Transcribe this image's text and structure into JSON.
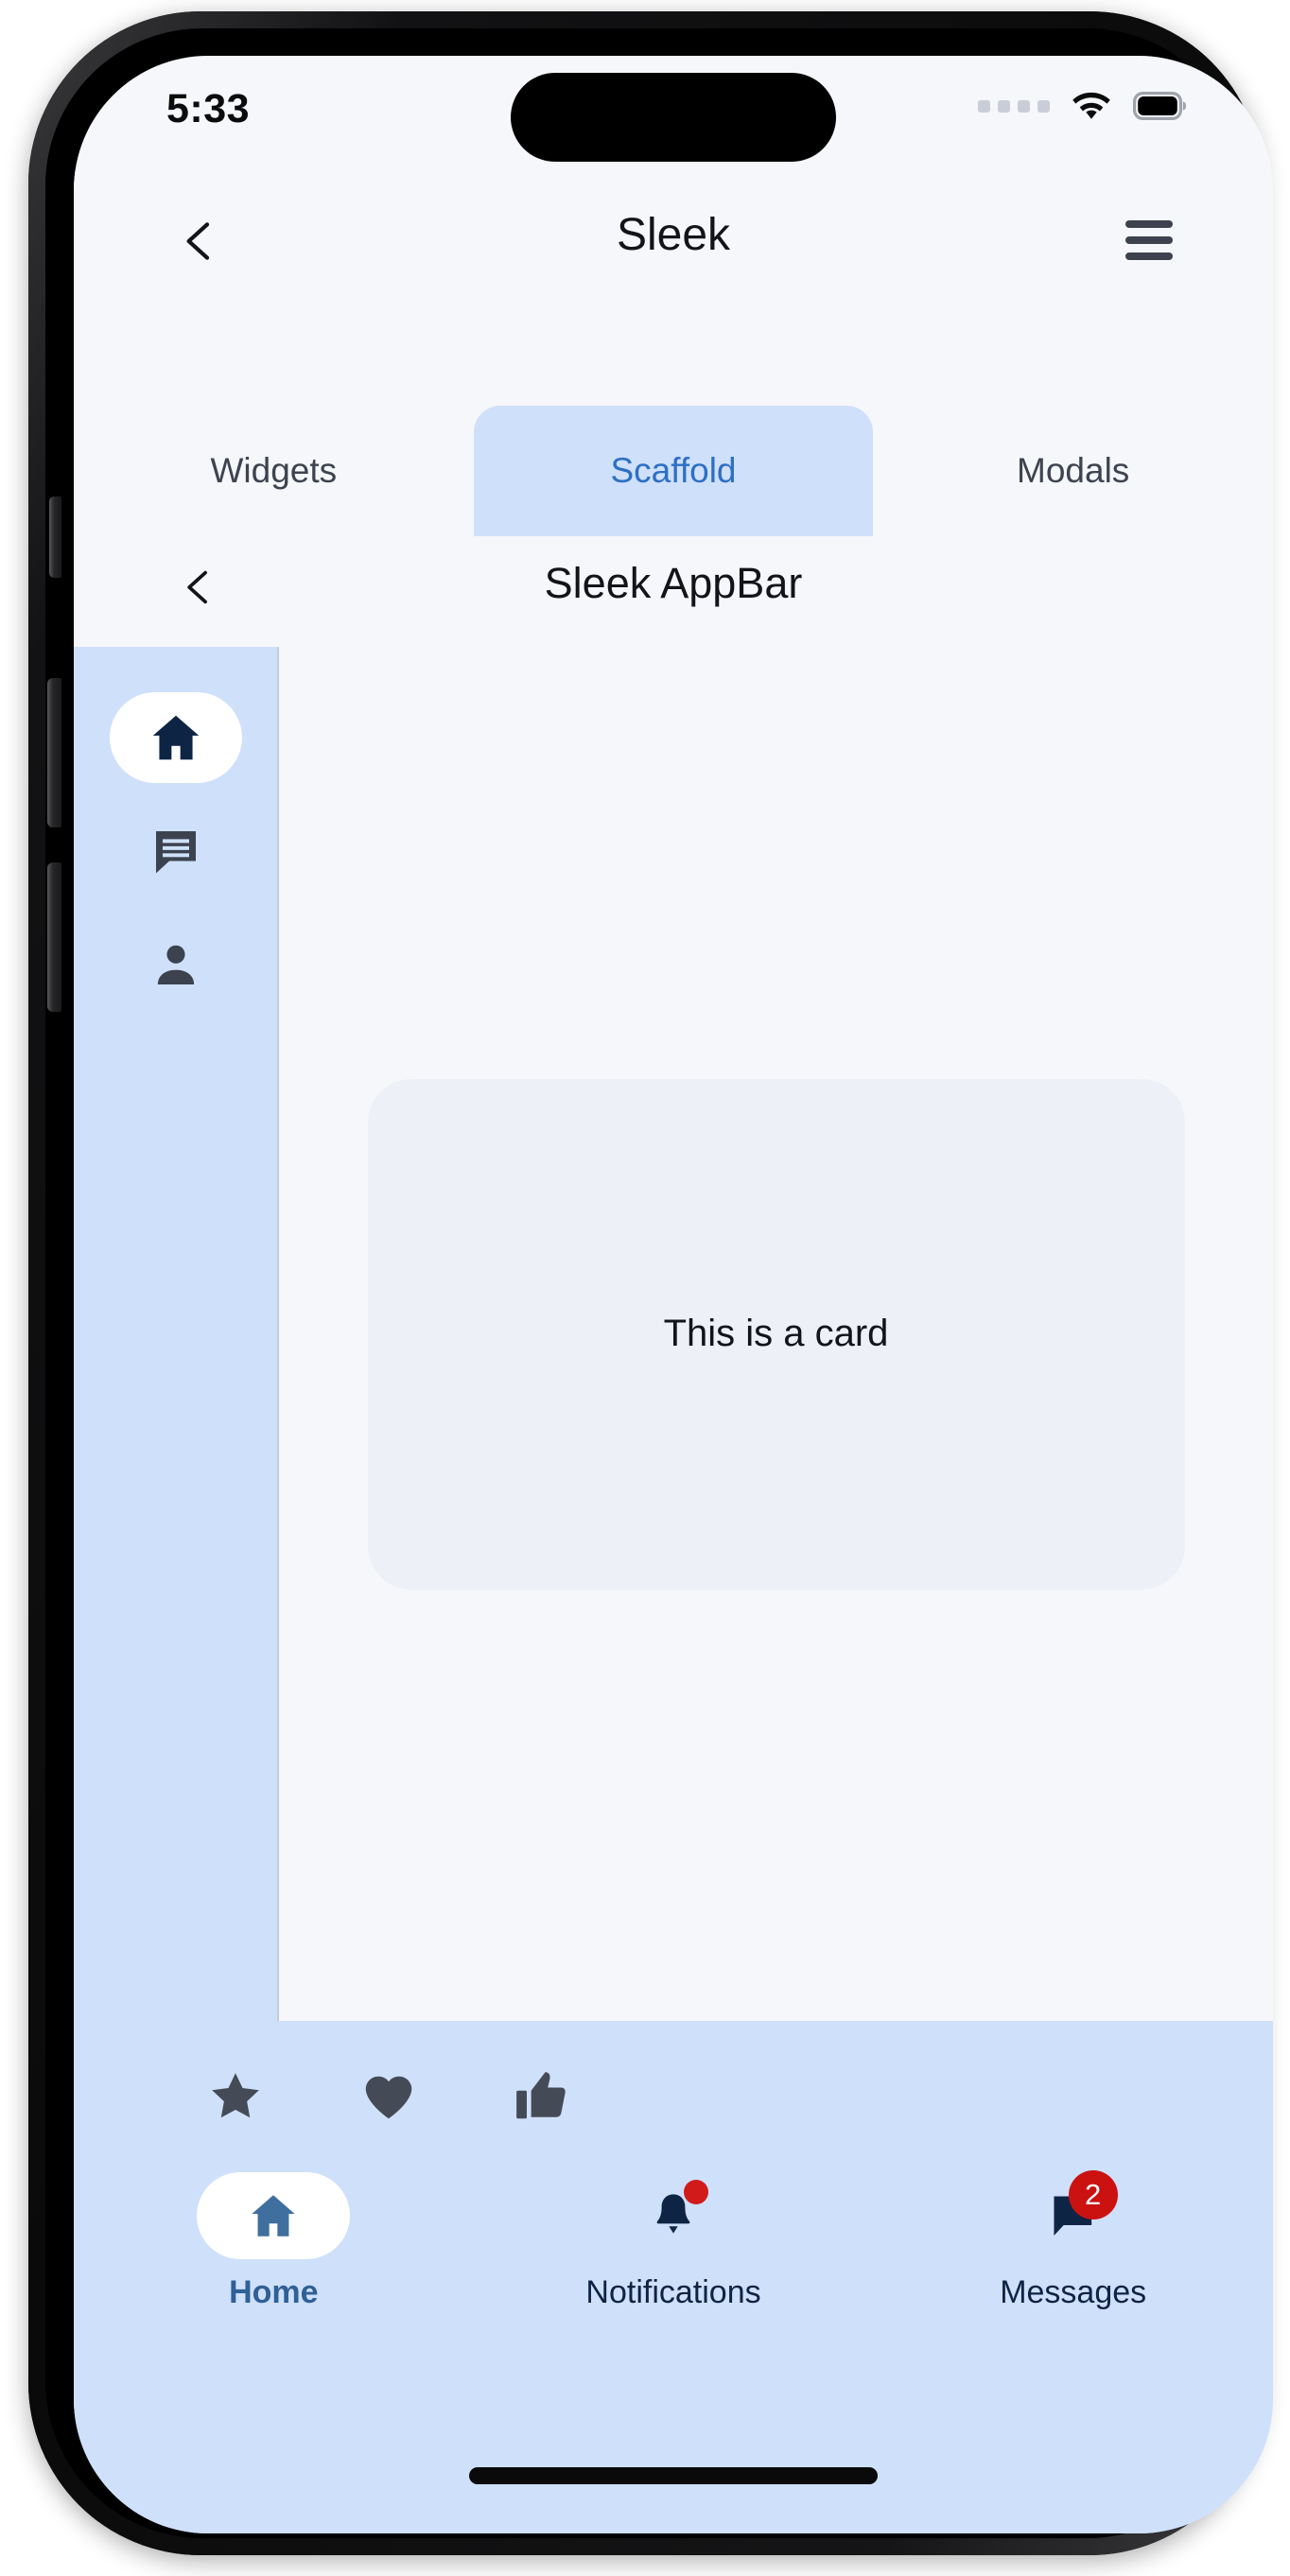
{
  "status_bar": {
    "time": "5:33",
    "signal_icon": "signal-dots-icon",
    "wifi_icon": "wifi-icon",
    "battery_icon": "battery-full-icon"
  },
  "app_bar": {
    "back_icon": "chevron-left-icon",
    "title": "Sleek",
    "menu_icon": "hamburger-menu-icon"
  },
  "tabs": [
    {
      "label": "Widgets",
      "active": false
    },
    {
      "label": "Scaffold",
      "active": true
    },
    {
      "label": "Modals",
      "active": false
    }
  ],
  "inner_app_bar": {
    "back_icon": "chevron-left-icon",
    "title": "Sleek AppBar"
  },
  "nav_rail": {
    "items": [
      {
        "icon": "home-icon",
        "selected": true
      },
      {
        "icon": "chat-message-icon",
        "selected": false
      },
      {
        "icon": "person-icon",
        "selected": false
      }
    ]
  },
  "body": {
    "card_text": "This is a card"
  },
  "action_row": {
    "items": [
      {
        "icon": "star-icon"
      },
      {
        "icon": "heart-icon"
      },
      {
        "icon": "thumb-up-icon"
      }
    ]
  },
  "bottom_nav": {
    "items": [
      {
        "label": "Home",
        "icon": "home-icon",
        "selected": true,
        "badge": null,
        "badge_dot": false
      },
      {
        "label": "Notifications",
        "icon": "bell-icon",
        "selected": false,
        "badge": null,
        "badge_dot": true
      },
      {
        "label": "Messages",
        "icon": "message-flag-icon",
        "selected": false,
        "badge": "2",
        "badge_dot": false
      }
    ]
  },
  "colors": {
    "accent_blue": "#2e6fc4",
    "surface_light": "#f6f7fb",
    "tab_active_bg": "#cfe0fb",
    "card_bg": "#eef0f8",
    "badge_red": "#cc1111",
    "nav_selected_text": "#2f6096",
    "icon_dark": "#3c434f",
    "icon_navy": "#0e2444"
  }
}
